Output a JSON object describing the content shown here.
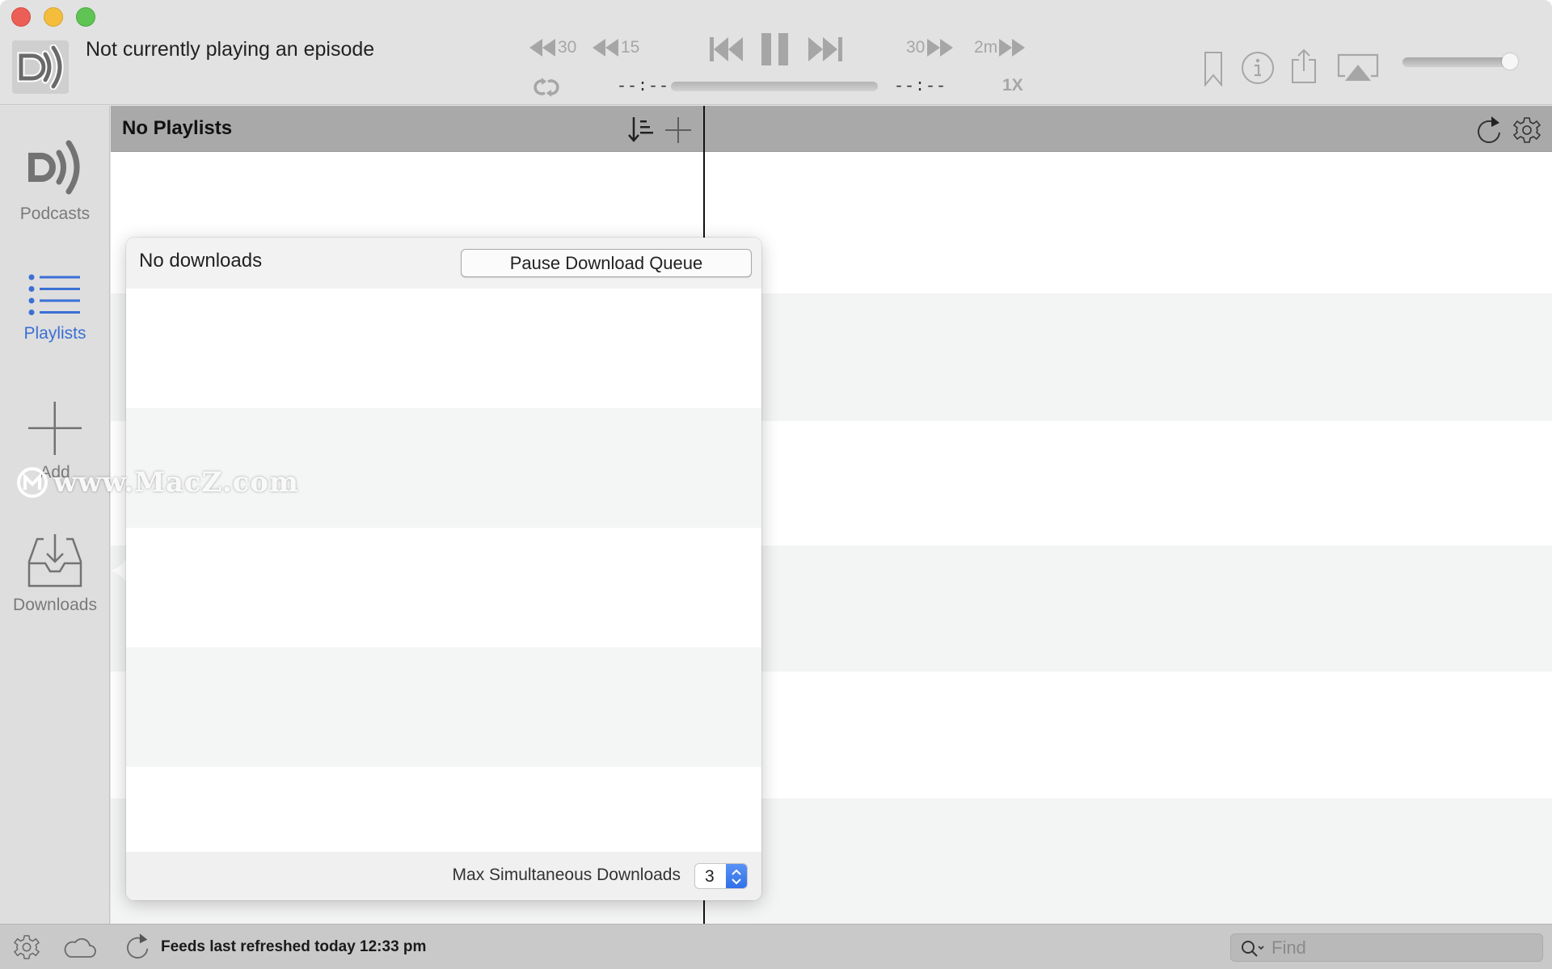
{
  "window": {
    "traffic_lights": [
      "close",
      "minimize",
      "zoom"
    ]
  },
  "player": {
    "now_playing": "Not currently playing an episode",
    "skip_back_long": "30",
    "skip_back_short": "15",
    "skip_forward_short": "30",
    "skip_forward_long": "2m",
    "elapsed": "--:--",
    "remaining": "--:--",
    "progress_percent": 0,
    "rate": "1X",
    "volume_percent": 95,
    "icons": {
      "artwork": "downcast-logo-icon",
      "repeat": "repeat-icon",
      "previous": "previous-track-icon",
      "pause": "pause-icon",
      "next": "next-track-icon",
      "bookmark": "bookmark-icon",
      "info": "info-icon",
      "share": "share-icon",
      "airplay": "airplay-icon"
    }
  },
  "sidebar": {
    "items": [
      {
        "label": "Podcasts",
        "icon": "podcasts-icon",
        "active": false
      },
      {
        "label": "Playlists",
        "icon": "playlists-icon",
        "active": true
      },
      {
        "label": "Add",
        "icon": "add-icon",
        "active": false
      },
      {
        "label": "Downloads",
        "icon": "downloads-icon",
        "active": false
      }
    ]
  },
  "playlists_pane": {
    "title": "No Playlists",
    "icons": {
      "sort": "sort-icon",
      "add": "plus-icon",
      "refresh": "refresh-icon",
      "settings": "gear-icon"
    }
  },
  "downloads_popover": {
    "status": "No downloads",
    "pause_button": "Pause Download Queue",
    "max_label": "Max Simultaneous Downloads",
    "max_value": "3"
  },
  "statusbar": {
    "refresh_text": "Feeds last refreshed today 12:33 pm",
    "find_placeholder": "Find",
    "icons": {
      "settings": "gear-icon",
      "cloud": "cloud-icon",
      "refresh": "refresh-icon",
      "search": "search-icon"
    }
  },
  "watermark": "www.MacZ.com",
  "colors": {
    "accent_blue": "#3b6fd4",
    "stepper_blue": "#2d6ee8",
    "close": "#ec5f57",
    "minimize": "#f4bd3c",
    "zoom": "#5fc453"
  }
}
